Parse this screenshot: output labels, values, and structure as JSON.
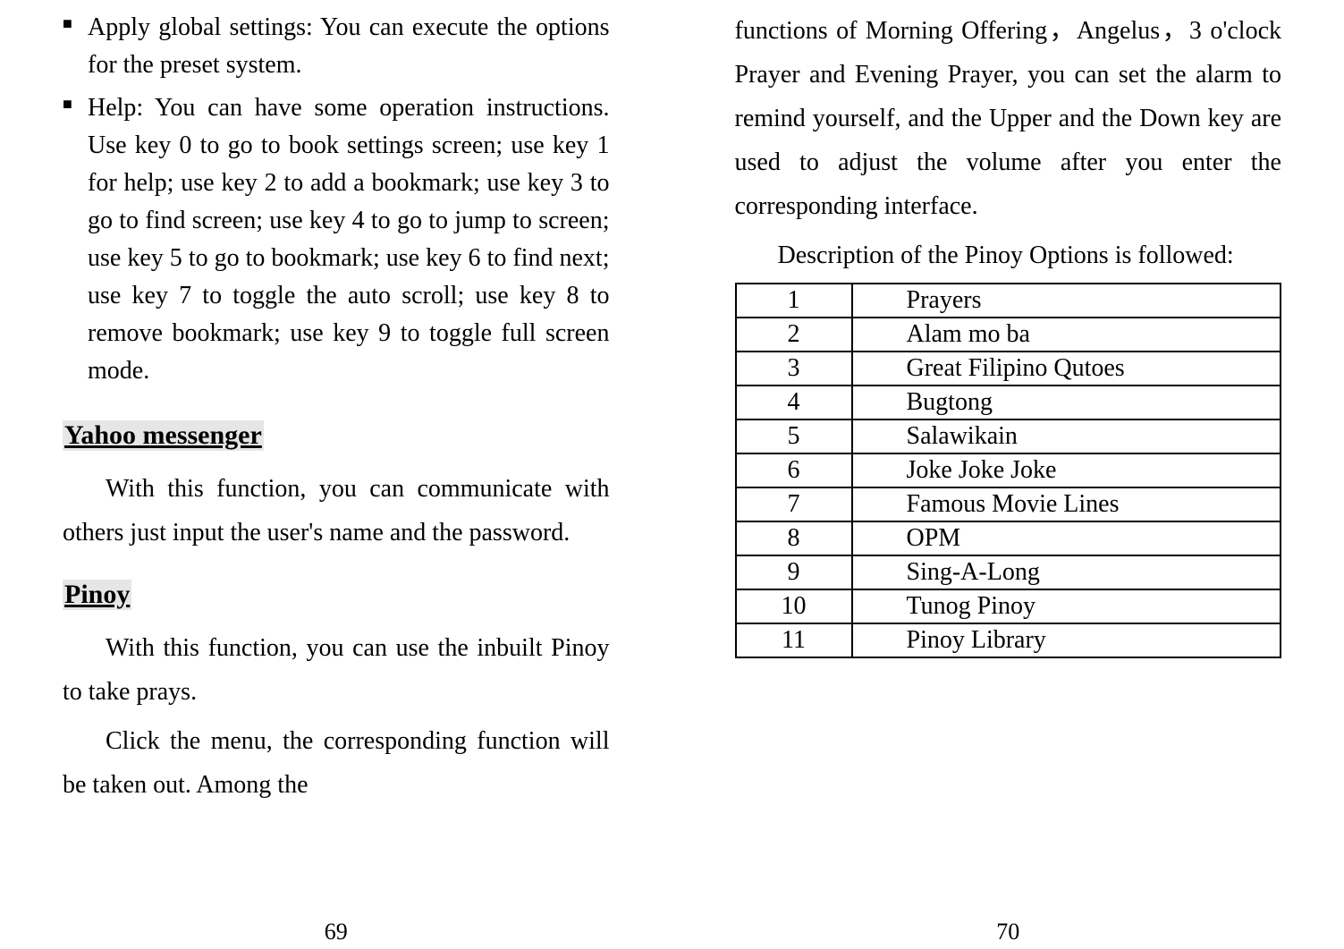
{
  "left": {
    "bullets": [
      "Apply global settings: You can execute the options for the preset system.",
      "Help: You can have some operation instructions. Use key 0 to go to book settings screen; use key 1 for help; use key 2 to add a bookmark; use key 3 to go to find screen; use key 4 to go to jump to screen; use key 5 to go to bookmark; use key 6 to find next; use key 7 to toggle the auto scroll; use key 8 to remove bookmark; use key 9 to toggle full screen mode."
    ],
    "section1": {
      "heading": "Yahoo messenger",
      "body": "With this function, you can communicate with others just input the user's name and the password."
    },
    "section2": {
      "heading": "Pinoy",
      "body": "With this function, you can use the inbuilt Pinoy to take prays.",
      "body2": "Click the menu, the corresponding function will be taken out. Among the"
    },
    "page_number": "69"
  },
  "right": {
    "continuation": "functions of Morning Offering，Angelus，3 o'clock Prayer and Evening Prayer, you can set the alarm to remind yourself, and the Upper and the Down key are used to adjust the volume after you enter the corresponding interface.",
    "desc": "Description of the Pinoy Options is followed:",
    "table": [
      {
        "n": "1",
        "label": "Prayers"
      },
      {
        "n": "2",
        "label": "Alam mo ba"
      },
      {
        "n": "3",
        "label": "Great Filipino Qutoes"
      },
      {
        "n": "4",
        "label": "Bugtong"
      },
      {
        "n": "5",
        "label": "Salawikain"
      },
      {
        "n": "6",
        "label": "Joke Joke Joke"
      },
      {
        "n": "7",
        "label": "Famous Movie Lines"
      },
      {
        "n": "8",
        "label": "OPM"
      },
      {
        "n": "9",
        "label": "Sing-A-Long"
      },
      {
        "n": "10",
        "label": "Tunog Pinoy"
      },
      {
        "n": "11",
        "label": "Pinoy Library"
      }
    ],
    "page_number": "70"
  }
}
